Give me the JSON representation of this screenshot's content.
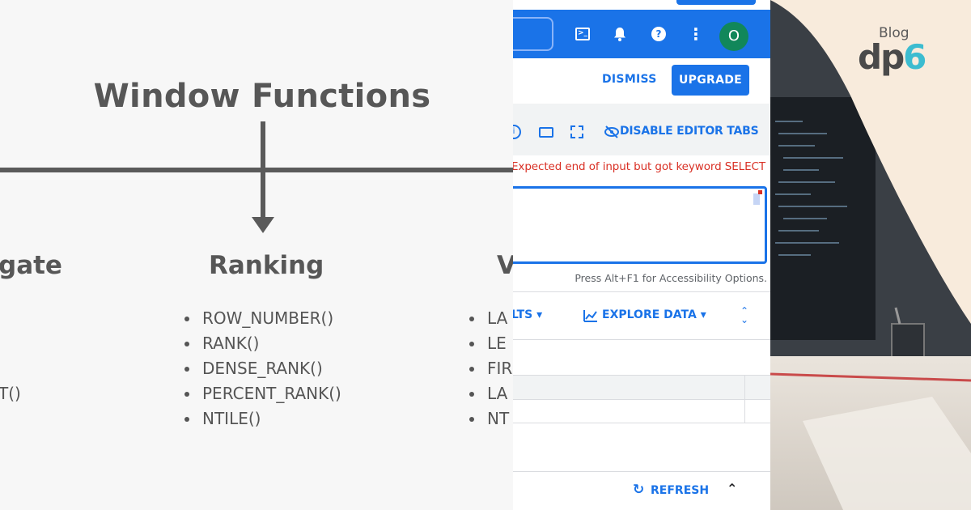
{
  "diagram": {
    "title": "Window Functions",
    "columns": [
      {
        "heading": "gate",
        "items": [
          "",
          "",
          "",
          "T()"
        ]
      },
      {
        "heading": "Ranking",
        "items": [
          "ROW_NUMBER()",
          "RANK()",
          "DENSE_RANK()",
          "PERCENT_RANK()",
          "NTILE()"
        ]
      },
      {
        "heading": "V",
        "items": [
          "LA",
          "LE",
          "FIR",
          "LA",
          "NT"
        ]
      }
    ]
  },
  "bigquery": {
    "topbar": {
      "avatar_letter": "O",
      "icons": [
        "cloud-shell-icon",
        "bell-icon",
        "help-icon",
        "more-vert-icon"
      ]
    },
    "banner": {
      "dismiss_label": "DISMISS",
      "upgrade_label": "UPGRADE"
    },
    "editor": {
      "disable_tabs_label": "DISABLE EDITOR TABS",
      "error_message": "Expected end of input but got keyword SELECT",
      "accessibility_hint": "Press Alt+F1 for Accessibility Options."
    },
    "results": {
      "results_label": "LTS",
      "explore_label": "EXPLORE DATA",
      "refresh_label": "REFRESH"
    },
    "colors": {
      "primary": "#1a73e8",
      "error": "#d93025",
      "avatar": "#11875a"
    }
  },
  "brand": {
    "blog_label": "Blog",
    "logo_main": "dp",
    "logo_accent": "6"
  }
}
